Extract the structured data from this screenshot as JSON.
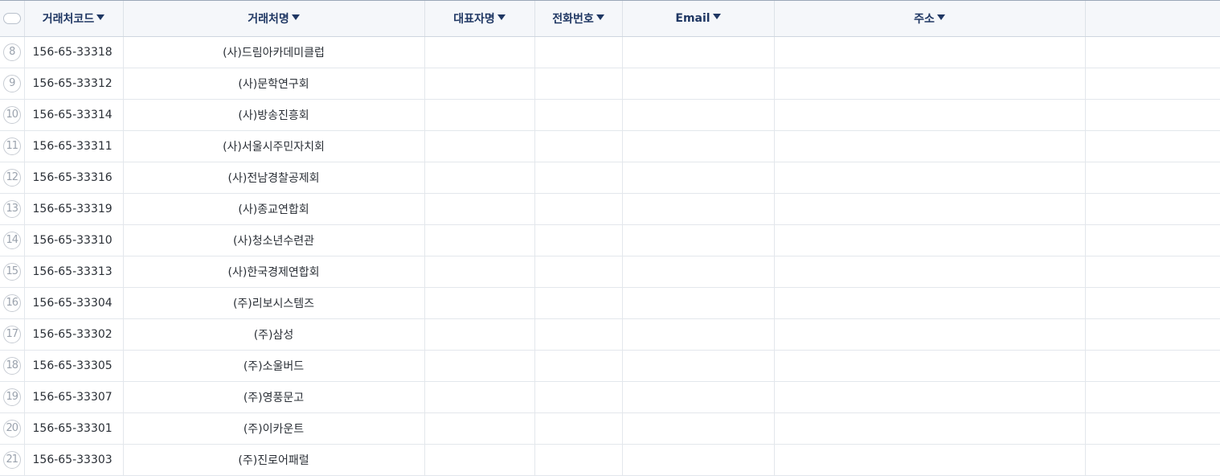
{
  "headers": {
    "code": "거래처코드",
    "name": "거래처명",
    "rep": "대표자명",
    "tel": "전화번호",
    "email": "Email",
    "addr": "주소"
  },
  "rows": [
    {
      "num": "8",
      "code": "156-65-33318",
      "name": "(사)드림아카데미클럽"
    },
    {
      "num": "9",
      "code": "156-65-33312",
      "name": "(사)문학연구회"
    },
    {
      "num": "10",
      "code": "156-65-33314",
      "name": "(사)방송진흥회"
    },
    {
      "num": "11",
      "code": "156-65-33311",
      "name": "(사)서울시주민자치회"
    },
    {
      "num": "12",
      "code": "156-65-33316",
      "name": "(사)전남경찰공제회"
    },
    {
      "num": "13",
      "code": "156-65-33319",
      "name": "(사)종교연합회"
    },
    {
      "num": "14",
      "code": "156-65-33310",
      "name": "(사)청소년수련관"
    },
    {
      "num": "15",
      "code": "156-65-33313",
      "name": "(사)한국경제연합회"
    },
    {
      "num": "16",
      "code": "156-65-33304",
      "name": "(주)리보시스템즈"
    },
    {
      "num": "17",
      "code": "156-65-33302",
      "name": "(주)삼성"
    },
    {
      "num": "18",
      "code": "156-65-33305",
      "name": "(주)소울버드"
    },
    {
      "num": "19",
      "code": "156-65-33307",
      "name": "(주)영풍문고"
    },
    {
      "num": "20",
      "code": "156-65-33301",
      "name": "(주)이카운트"
    },
    {
      "num": "21",
      "code": "156-65-33303",
      "name": "(주)진로어패럴"
    }
  ]
}
